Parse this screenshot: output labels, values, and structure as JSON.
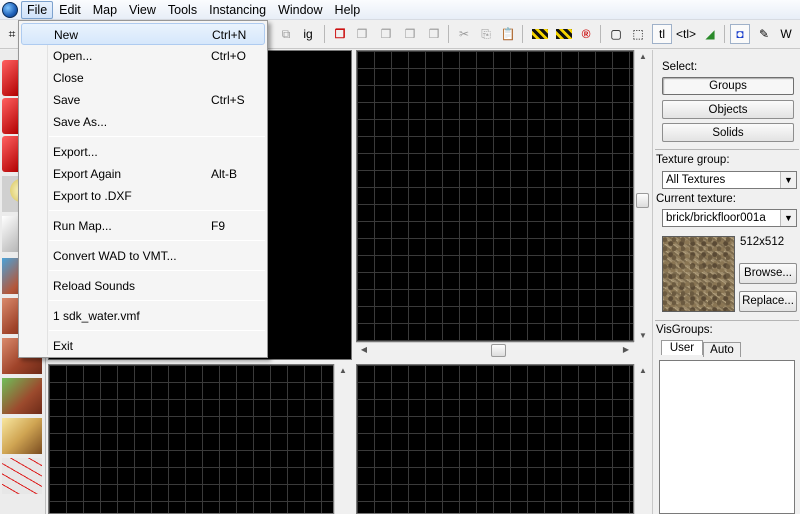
{
  "menubar": {
    "items": [
      "File",
      "Edit",
      "Map",
      "View",
      "Tools",
      "Instancing",
      "Window",
      "Help"
    ]
  },
  "toolbar": {
    "text_buttons": {
      "ig": "ig",
      "tl": "tl",
      "tl_arrows": "<tl>"
    }
  },
  "file_menu": {
    "items": [
      {
        "label": "New",
        "shortcut": "Ctrl+N"
      },
      {
        "label": "Open...",
        "shortcut": "Ctrl+O"
      },
      {
        "label": "Close",
        "shortcut": ""
      },
      {
        "label": "Save",
        "shortcut": "Ctrl+S"
      },
      {
        "label": "Save As...",
        "shortcut": ""
      },
      {
        "label": "Export...",
        "shortcut": ""
      },
      {
        "label": "Export Again",
        "shortcut": "Alt-B"
      },
      {
        "label": "Export to .DXF",
        "shortcut": ""
      },
      {
        "label": "Run Map...",
        "shortcut": "F9"
      },
      {
        "label": "Convert WAD to VMT...",
        "shortcut": ""
      },
      {
        "label": "Reload Sounds",
        "shortcut": ""
      },
      {
        "label": "1 sdk_water.vmf",
        "shortcut": ""
      },
      {
        "label": "Exit",
        "shortcut": ""
      }
    ]
  },
  "right_panel": {
    "select_label": "Select:",
    "select_buttons": [
      "Groups",
      "Objects",
      "Solids"
    ],
    "texture_group_label": "Texture group:",
    "texture_group_value": "All Textures",
    "current_texture_label": "Current texture:",
    "current_texture_value": "brick/brickfloor001a",
    "texture_size": "512x512",
    "browse_button": "Browse...",
    "replace_button": "Replace...",
    "visgroups_label": "VisGroups:",
    "tabs": [
      "User",
      "Auto"
    ]
  },
  "colors": {
    "viewport_bg": "#000000",
    "grid_line": "#3a3a3a",
    "menu_highlight": "#d6e7fb"
  }
}
